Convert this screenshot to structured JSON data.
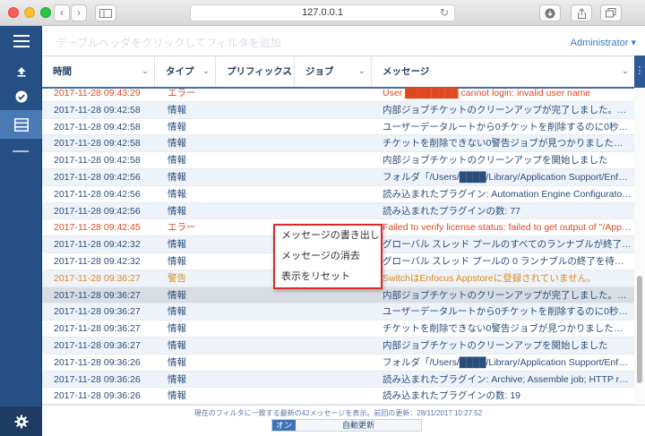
{
  "browser": {
    "url": "127.0.0.1"
  },
  "header": {
    "filter_hint": "テーブルヘッダをクリックしてフィルタを追加",
    "user_menu": "Administrator"
  },
  "table": {
    "columns": [
      "時間",
      "タイプ",
      "プリフィックス",
      "ジョブ",
      "メッセージ"
    ],
    "rows": [
      {
        "time": "2017-11-28 09:43:29",
        "type": "エラー",
        "message": "User ████████ cannot login: invalid user name",
        "level": "err"
      },
      {
        "time": "2017-11-28 09:42:58",
        "type": "情報",
        "message": "内部ジョブチケットのクリーンアップが完了しました。クリー...",
        "level": "info"
      },
      {
        "time": "2017-11-28 09:42:58",
        "type": "情報",
        "message": "ユーザーデータルートから0チケットを削除するのに0秒かかり...",
        "level": "info"
      },
      {
        "time": "2017-11-28 09:42:58",
        "type": "情報",
        "message": "チケットを削除できない0警告ジョブが見つかりました。クラ...",
        "level": "info"
      },
      {
        "time": "2017-11-28 09:42:58",
        "type": "情報",
        "message": "内部ジョブチケットのクリーンアップを開始しました",
        "level": "info"
      },
      {
        "time": "2017-11-28 09:42:56",
        "type": "情報",
        "message": "フォルダ「/Users/████/Library/Application Support/Enfocus/...",
        "level": "info"
      },
      {
        "time": "2017-11-28 09:42:56",
        "type": "情報",
        "message": "読み込まれたプラグイン: Automation Engine Configurator; Ad...",
        "level": "info"
      },
      {
        "time": "2017-11-28 09:42:56",
        "type": "情報",
        "message": "読み込まれたプラグインの数: 77",
        "level": "info"
      },
      {
        "time": "2017-11-28 09:42:45",
        "type": "エラー",
        "message": "Failed to verify license status: failed to get output of \"/Applicati...",
        "level": "err"
      },
      {
        "time": "2017-11-28 09:42:32",
        "type": "情報",
        "message": "グローバル スレッド プールのすべてのランナブルが終了して...",
        "level": "info"
      },
      {
        "time": "2017-11-28 09:42:32",
        "type": "情報",
        "message": "グローバル スレッド プールの 0 ランナブルの終了を待機中",
        "level": "info"
      },
      {
        "time": "2017-11-28 09:36:27",
        "type": "警告",
        "message": "SwitchはEnfocus Appstoreに登録されていません。",
        "level": "warn"
      },
      {
        "time": "2017-11-28 09:36:27",
        "type": "情報",
        "message": "内部ジョブチケットのクリーンアップが完了しました。クリー...",
        "level": "info"
      },
      {
        "time": "2017-11-28 09:36:27",
        "type": "情報",
        "message": "ユーザーデータルートから0チケットを削除するのに0秒かかり...",
        "level": "info"
      },
      {
        "time": "2017-11-28 09:36:27",
        "type": "情報",
        "message": "チケットを削除できない0警告ジョブが見つかりました。クラ...",
        "level": "info"
      },
      {
        "time": "2017-11-28 09:36:27",
        "type": "情報",
        "message": "内部ジョブチケットのクリーンアップを開始しました",
        "level": "info"
      },
      {
        "time": "2017-11-28 09:36:26",
        "type": "情報",
        "message": "フォルダ「/Users/████/Library/Application Support/Enfocus/...",
        "level": "info"
      },
      {
        "time": "2017-11-28 09:36:26",
        "type": "情報",
        "message": "読み込まれたプラグイン: Archive; Assemble job; HTTP reque...",
        "level": "info"
      },
      {
        "time": "2017-11-28 09:36:26",
        "type": "情報",
        "message": "読み込まれたプラグインの数: 19",
        "level": "info"
      }
    ]
  },
  "context_menu": {
    "items": [
      "メッセージの書き出し",
      "メッセージの消去",
      "表示をリセット"
    ]
  },
  "footer": {
    "status": "現在のフィルタに一致する最新の42メッセージを表示。前回の更新：28/11/2017 10:27:52",
    "toggle_on": "オン",
    "auto_refresh": "自動更新"
  },
  "colors": {
    "sidebar": "#264f85",
    "accent": "#3d72b8",
    "error": "#e0491f",
    "warning": "#e08a1f",
    "menu_outline": "#d82a2a"
  }
}
